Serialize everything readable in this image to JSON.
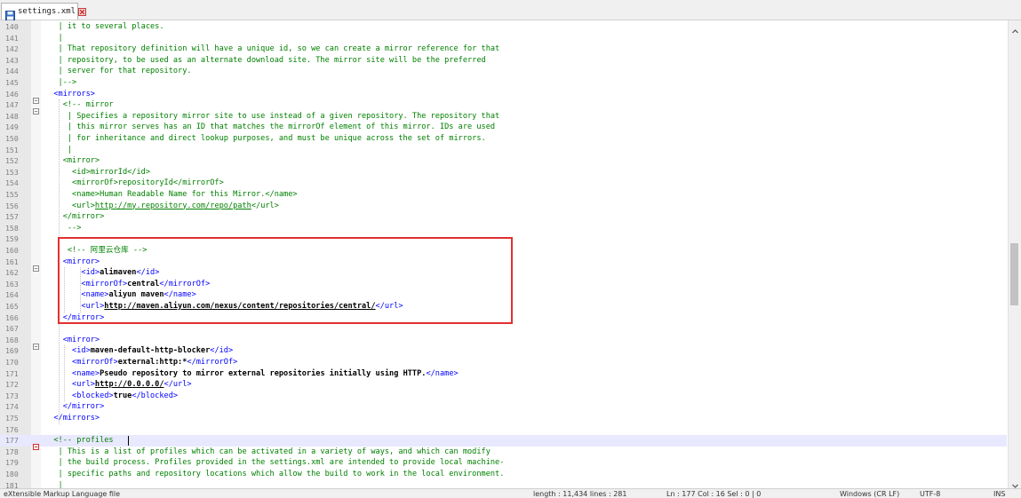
{
  "tab": {
    "filename": "settings.xml"
  },
  "lines": [
    {
      "n": "140",
      "fold": "",
      "cur": false,
      "segs": [
        [
          "c",
          "   | it to several places."
        ]
      ]
    },
    {
      "n": "141",
      "fold": "",
      "cur": false,
      "segs": [
        [
          "c",
          "   |"
        ]
      ]
    },
    {
      "n": "142",
      "fold": "",
      "cur": false,
      "segs": [
        [
          "c",
          "   | That repository definition will have a unique id, so we can create a mirror reference for that"
        ]
      ]
    },
    {
      "n": "143",
      "fold": "",
      "cur": false,
      "segs": [
        [
          "c",
          "   | repository, to be used as an alternate download site. The mirror site will be the preferred"
        ]
      ]
    },
    {
      "n": "144",
      "fold": "",
      "cur": false,
      "segs": [
        [
          "c",
          "   | server for that repository."
        ]
      ]
    },
    {
      "n": "145",
      "fold": "",
      "cur": false,
      "segs": [
        [
          "c",
          "   |-->"
        ]
      ]
    },
    {
      "n": "146",
      "fold": "minus",
      "cur": false,
      "segs": [
        [
          "t",
          "  <mirrors>"
        ]
      ]
    },
    {
      "n": "147",
      "fold": "minus",
      "cur": false,
      "segs": [
        [
          "c",
          "    <!-- mirror"
        ]
      ]
    },
    {
      "n": "148",
      "fold": "",
      "cur": false,
      "segs": [
        [
          "c",
          "     | Specifies a repository mirror site to use instead of a given repository. The repository that"
        ]
      ]
    },
    {
      "n": "149",
      "fold": "",
      "cur": false,
      "segs": [
        [
          "c",
          "     | this mirror serves has an ID that matches the mirrorOf element of this mirror. IDs are used"
        ]
      ]
    },
    {
      "n": "150",
      "fold": "",
      "cur": false,
      "segs": [
        [
          "c",
          "     | for inheritance and direct lookup purposes, and must be unique across the set of mirrors."
        ]
      ]
    },
    {
      "n": "151",
      "fold": "",
      "cur": false,
      "segs": [
        [
          "c",
          "     |"
        ]
      ]
    },
    {
      "n": "152",
      "fold": "",
      "cur": false,
      "segs": [
        [
          "c",
          "    <mirror>"
        ]
      ]
    },
    {
      "n": "153",
      "fold": "",
      "cur": false,
      "segs": [
        [
          "c",
          "      <id>mirrorId</id>"
        ]
      ]
    },
    {
      "n": "154",
      "fold": "",
      "cur": false,
      "segs": [
        [
          "c",
          "      <mirrorOf>repositoryId</mirrorOf>"
        ]
      ]
    },
    {
      "n": "155",
      "fold": "",
      "cur": false,
      "segs": [
        [
          "c",
          "      <name>Human Readable Name for this Mirror.</name>"
        ]
      ]
    },
    {
      "n": "156",
      "fold": "",
      "cur": false,
      "segs": [
        [
          "c",
          "      <url>"
        ],
        [
          "ul",
          "http://my.repository.com/repo/path"
        ],
        [
          "c",
          "</url>"
        ]
      ]
    },
    {
      "n": "157",
      "fold": "",
      "cur": false,
      "segs": [
        [
          "c",
          "    </mirror>"
        ]
      ]
    },
    {
      "n": "158",
      "fold": "",
      "cur": false,
      "segs": [
        [
          "c",
          "     -->"
        ]
      ]
    },
    {
      "n": "159",
      "fold": "",
      "cur": false,
      "segs": [
        [
          "x",
          ""
        ]
      ]
    },
    {
      "n": "160",
      "fold": "",
      "cur": false,
      "segs": [
        [
          "c",
          "     <!-- 阿里云仓库 -->"
        ]
      ]
    },
    {
      "n": "161",
      "fold": "minus",
      "cur": false,
      "segs": [
        [
          "t",
          "    <mirror>"
        ]
      ]
    },
    {
      "n": "162",
      "fold": "",
      "cur": false,
      "segs": [
        [
          "t",
          "        <id>"
        ],
        [
          "b",
          "alimaven"
        ],
        [
          "t",
          "</id>"
        ]
      ]
    },
    {
      "n": "163",
      "fold": "",
      "cur": false,
      "segs": [
        [
          "t",
          "        <mirrorOf>"
        ],
        [
          "b",
          "central"
        ],
        [
          "t",
          "</mirrorOf>"
        ]
      ]
    },
    {
      "n": "164",
      "fold": "",
      "cur": false,
      "segs": [
        [
          "t",
          "        <name>"
        ],
        [
          "b",
          "aliyun maven"
        ],
        [
          "t",
          "</name>"
        ]
      ]
    },
    {
      "n": "165",
      "fold": "",
      "cur": false,
      "segs": [
        [
          "t",
          "        <url>"
        ],
        [
          "u",
          "http://maven.aliyun.com/nexus/content/repositories/central/"
        ],
        [
          "t",
          "</url>"
        ]
      ]
    },
    {
      "n": "166",
      "fold": "",
      "cur": false,
      "segs": [
        [
          "t",
          "    </mirror>"
        ]
      ]
    },
    {
      "n": "167",
      "fold": "",
      "cur": false,
      "segs": [
        [
          "x",
          ""
        ]
      ]
    },
    {
      "n": "168",
      "fold": "minus",
      "cur": false,
      "segs": [
        [
          "t",
          "    <mirror>"
        ]
      ]
    },
    {
      "n": "169",
      "fold": "",
      "cur": false,
      "segs": [
        [
          "t",
          "      <id>"
        ],
        [
          "b",
          "maven-default-http-blocker"
        ],
        [
          "t",
          "</id>"
        ]
      ]
    },
    {
      "n": "170",
      "fold": "",
      "cur": false,
      "segs": [
        [
          "t",
          "      <mirrorOf>"
        ],
        [
          "b",
          "external:http:*"
        ],
        [
          "t",
          "</mirrorOf>"
        ]
      ]
    },
    {
      "n": "171",
      "fold": "",
      "cur": false,
      "segs": [
        [
          "t",
          "      <name>"
        ],
        [
          "b",
          "Pseudo repository to mirror external repositories initially using HTTP."
        ],
        [
          "t",
          "</name>"
        ]
      ]
    },
    {
      "n": "172",
      "fold": "",
      "cur": false,
      "segs": [
        [
          "t",
          "      <url>"
        ],
        [
          "u",
          "http://0.0.0.0/"
        ],
        [
          "t",
          "</url>"
        ]
      ]
    },
    {
      "n": "173",
      "fold": "",
      "cur": false,
      "segs": [
        [
          "t",
          "      <blocked>"
        ],
        [
          "b",
          "true"
        ],
        [
          "t",
          "</blocked>"
        ]
      ]
    },
    {
      "n": "174",
      "fold": "",
      "cur": false,
      "segs": [
        [
          "t",
          "    </mirror>"
        ]
      ]
    },
    {
      "n": "175",
      "fold": "",
      "cur": false,
      "segs": [
        [
          "t",
          "  </mirrors>"
        ]
      ]
    },
    {
      "n": "176",
      "fold": "",
      "cur": false,
      "segs": [
        [
          "x",
          ""
        ]
      ]
    },
    {
      "n": "177",
      "fold": "minus-red",
      "cur": true,
      "segs": [
        [
          "c",
          "  <!-- profiles"
        ]
      ]
    },
    {
      "n": "178",
      "fold": "",
      "cur": false,
      "segs": [
        [
          "c",
          "   | This is a list of profiles which can be activated in a variety of ways, and which can modify"
        ]
      ]
    },
    {
      "n": "179",
      "fold": "",
      "cur": false,
      "segs": [
        [
          "c",
          "   | the build process. Profiles provided in the settings.xml are intended to provide local machine-"
        ]
      ]
    },
    {
      "n": "180",
      "fold": "",
      "cur": false,
      "segs": [
        [
          "c",
          "   | specific paths and repository locations which allow the build to work in the local environment."
        ]
      ]
    },
    {
      "n": "181",
      "fold": "",
      "cur": false,
      "segs": [
        [
          "c",
          "   |"
        ]
      ]
    }
  ],
  "status": {
    "file_type": "eXtensible Markup Language file",
    "length": "length : 11,434    lines : 281",
    "position": "Ln : 177    Col : 16    Sel : 0 | 0",
    "eol": "Windows (CR LF)",
    "encoding": "UTF-8",
    "mode": "INS"
  },
  "colors": {
    "highlight_border": "#e03030",
    "current_line": "#e8e8ff",
    "comment": "#008000",
    "tag": "#0000ff"
  }
}
